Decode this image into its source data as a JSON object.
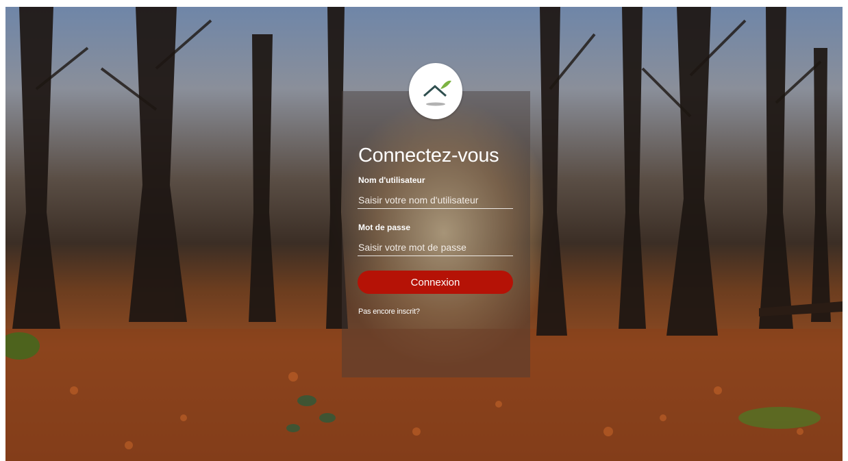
{
  "login": {
    "title": "Connectez-vous",
    "username_label": "Nom d'utilisateur",
    "username_placeholder": "Saisir votre nom d'utilisateur",
    "password_label": "Mot de passe",
    "password_placeholder": "Saisir votre mot de passe",
    "submit_label": "Connexion",
    "register_link": "Pas encore inscrit?"
  },
  "colors": {
    "button": "#b51206",
    "logo_green": "#7cb342",
    "logo_dark": "#2f4f4f"
  },
  "icons": {
    "logo": "mountain-leaf-logo-icon"
  }
}
